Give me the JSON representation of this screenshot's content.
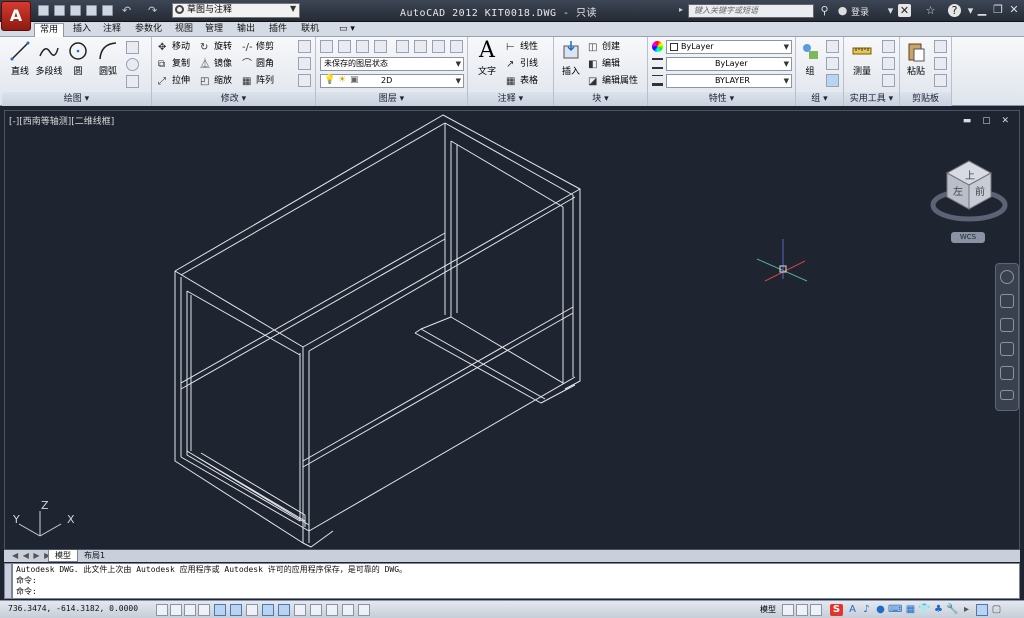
{
  "titlebar": {
    "app_menu_letter": "A",
    "workspace": "草图与注释",
    "title": "AutoCAD 2012    KIT0018.DWG - 只读",
    "help_search_placeholder": "键入关键字或短语",
    "signin": "登录",
    "icons": [
      "x-mark-icon",
      "star-icon",
      "help-icon"
    ]
  },
  "ribbon_tabs": [
    "常用",
    "插入",
    "注释",
    "参数化",
    "视图",
    "管理",
    "输出",
    "插件",
    "联机",
    "▭ ▾"
  ],
  "panels": {
    "draw": {
      "title": "绘图 ▾",
      "buttons": [
        "直线",
        "多段线",
        "圆",
        "圆弧"
      ]
    },
    "modify": {
      "title": "修改 ▾",
      "items": [
        "移动",
        "旋转",
        "修剪",
        "复制",
        "镜像",
        "圆角",
        "拉伸",
        "缩放",
        "阵列"
      ]
    },
    "layers": {
      "title": "图层 ▾",
      "state": "未保存的图层状态",
      "layer": "2D"
    },
    "annotation": {
      "title": "注释 ▾",
      "text": "文字",
      "items": [
        "线性",
        "引线",
        "表格"
      ]
    },
    "block": {
      "title": "块 ▾",
      "insert": "插入",
      "items": [
        "创建",
        "编辑",
        "编辑属性"
      ]
    },
    "properties": {
      "title": "特性 ▾",
      "color": "ByLayer",
      "linetype": "ByLayer",
      "lineweight": "BYLAYER"
    },
    "groups": {
      "title": "组 ▾",
      "group": "组"
    },
    "utilities": {
      "title": "实用工具 ▾",
      "measure": "测量"
    },
    "clipboard": {
      "title": "剪贴板",
      "paste": "粘贴"
    }
  },
  "viewport": {
    "label": "[-][西南等轴测][二维线框]",
    "controls": "▬ ▢ ✕",
    "viewcube_top": "上",
    "viewcube_left": "左",
    "viewcube_front": "前",
    "wcs": "WCS",
    "ucs_labels": {
      "x": "X",
      "y": "Y",
      "z": "Z"
    }
  },
  "layout_tabs": [
    "模型",
    "布局1"
  ],
  "layout_nav": "◀ ◀ ▶ ▶",
  "command": {
    "line1": "Autodesk DWG.    此文件上次由 Autodesk 应用程序或 Autodesk 许可的应用程序保存，是可靠的 DWG。",
    "line2": "命令:",
    "line3": "命令:"
  },
  "status": {
    "coords": "736.3474,   -614.3182, 0.0000",
    "model": "模型",
    "tray_icons": [
      "S",
      "A",
      "♪",
      "●",
      "⌨",
      "▦",
      "👕",
      "♣",
      "🔧",
      "▸",
      "▢"
    ]
  }
}
